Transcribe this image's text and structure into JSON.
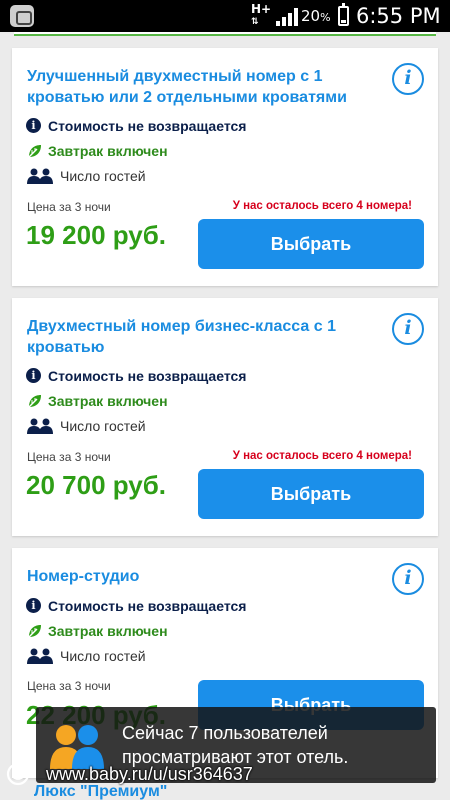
{
  "status_bar": {
    "network": "H+",
    "battery_percent": "20",
    "percent_sign": "%",
    "time": "6:55 PM"
  },
  "rooms": [
    {
      "title": "Улучшенный двухместный номер с 1 кроватью или 2 отдельными кроватями",
      "policy": "Стоимость не возвращается",
      "breakfast": "Завтрак включен",
      "guests": "Число гостей",
      "price_label": "Цена за 3 ночи",
      "scarcity": "У нас осталось всего 4 номера!",
      "price": "19 200 руб.",
      "button": "Выбрать"
    },
    {
      "title": "Двухместный номер бизнес-класса с 1 кроватью",
      "policy": "Стоимость не возвращается",
      "breakfast": "Завтрак включен",
      "guests": "Число гостей",
      "price_label": "Цена за 3 ночи",
      "scarcity": "У нас осталось всего 4 номера!",
      "price": "20 700 руб.",
      "button": "Выбрать"
    },
    {
      "title": "Номер-студио",
      "policy": "Стоимость не возвращается",
      "breakfast": "Завтрак включен",
      "guests": "Число гостей",
      "price_label": "Цена за 3 ночи",
      "price": "22 200 руб.",
      "button": "Выбрать"
    }
  ],
  "next_room_title_peek": "Люкс \"Премиум\"",
  "toast": {
    "message": "Сейчас 7 пользователей просматривают этот отель."
  },
  "watermark": "www.baby.ru/u/usr364637",
  "icons": {
    "info_button": "info-circle-icon",
    "policy": "info-filled-icon",
    "breakfast": "leaf-icon",
    "guests": "people-icon"
  },
  "colors": {
    "title_blue": "#1a8ce0",
    "button_blue": "#1b8fea",
    "price_green": "#2e9e16",
    "scarcity_red": "#d6001c",
    "navy": "#0b1f4a"
  }
}
